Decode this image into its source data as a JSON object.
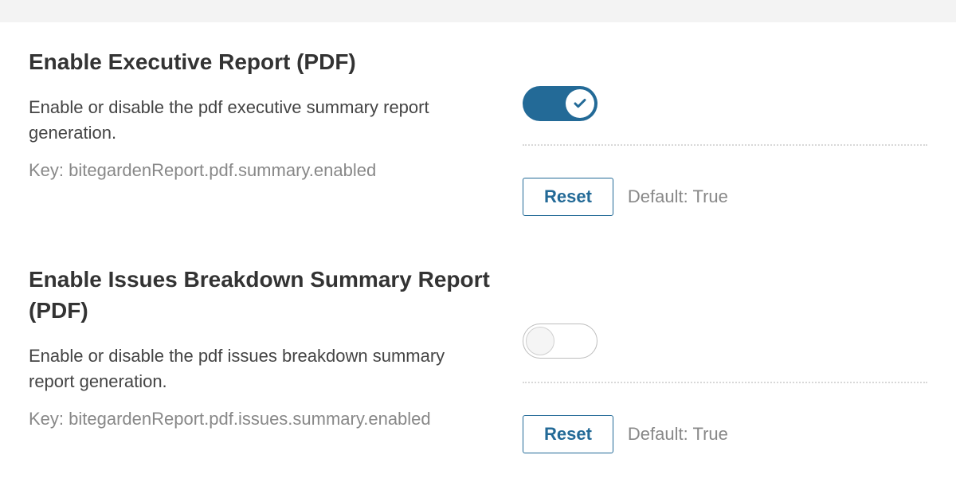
{
  "settings": [
    {
      "title": "Enable Executive Report (PDF)",
      "description": "Enable or disable the pdf executive summary report generation.",
      "key": "Key: bitegardenReport.pdf.summary.enabled",
      "enabled": true,
      "reset_label": "Reset",
      "default_text": "Default: True"
    },
    {
      "title": "Enable Issues Breakdown Summary Report (PDF)",
      "description": "Enable or disable the pdf issues breakdown summary report generation.",
      "key": "Key: bitegardenReport.pdf.issues.summary.enabled",
      "enabled": false,
      "reset_label": "Reset",
      "default_text": "Default: True"
    }
  ]
}
